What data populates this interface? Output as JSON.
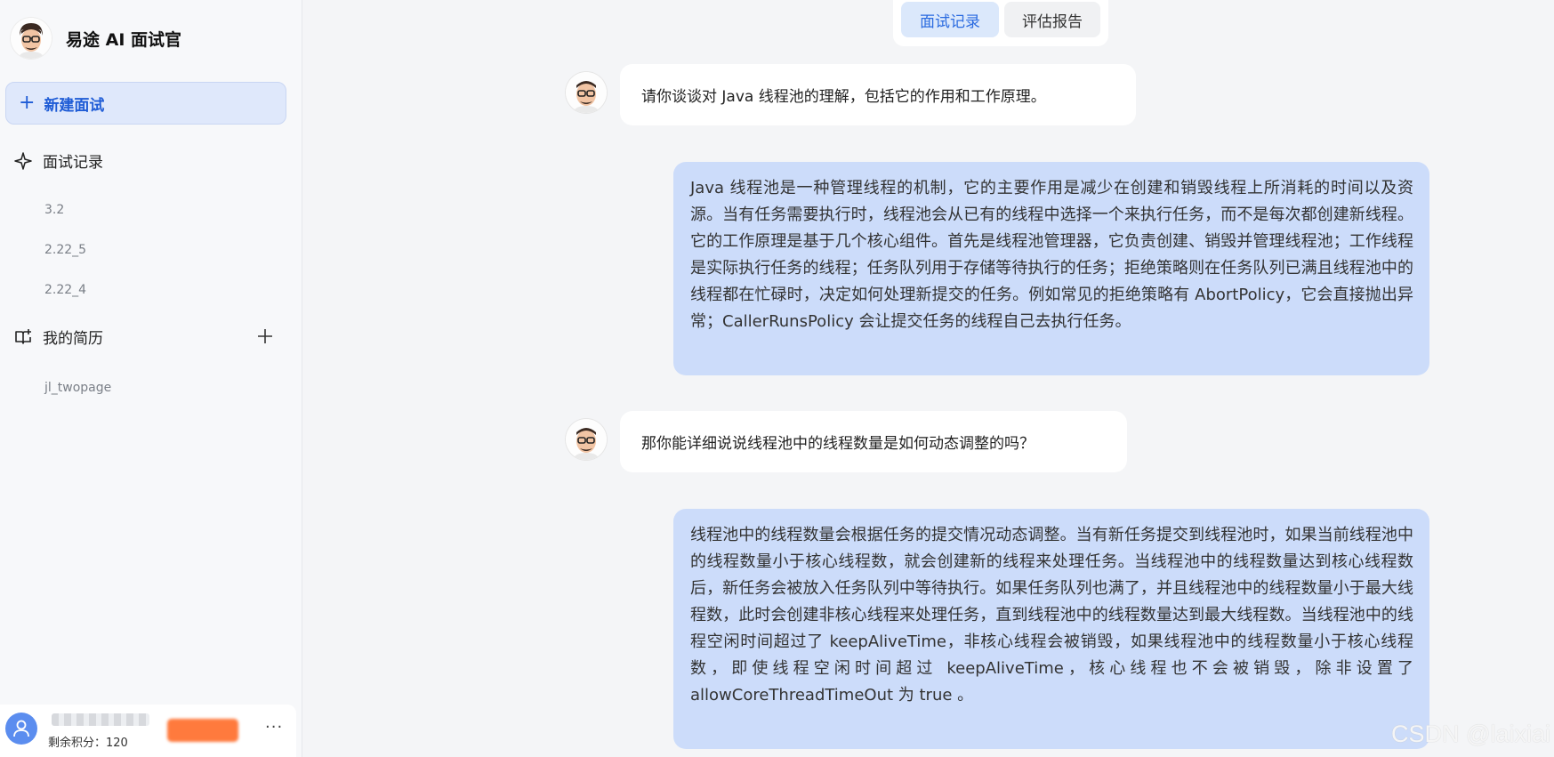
{
  "brand": {
    "title": "易途 AI 面试官"
  },
  "sidebar": {
    "new_interview": "新建面试",
    "records_label": "面试记录",
    "records": [
      "3.2",
      "2.22_5",
      "2.22_4"
    ],
    "resume_label": "我的简历",
    "resumes": [
      "jl_twopage"
    ]
  },
  "user": {
    "points_label": "剩余积分：",
    "points_value": "120",
    "more": "···"
  },
  "tabs": {
    "records": "面试记录",
    "report": "评估报告"
  },
  "chat": [
    {
      "role": "interviewer",
      "text": "请你谈谈对 Java 线程池的理解，包括它的作用和工作原理。"
    },
    {
      "role": "candidate",
      "text": "Java 线程池是一种管理线程的机制，它的主要作用是减少在创建和销毁线程上所消耗的时间以及资源。当有任务需要执行时，线程池会从已有的线程中选择一个来执行任务，而不是每次都创建新线程。它的工作原理是基于几个核心组件。首先是线程池管理器，它负责创建、销毁并管理线程池；工作线程是实际执行任务的线程；任务队列用于存储等待执行的任务；拒绝策略则在任务队列已满且线程池中的线程都在忙碌时，决定如何处理新提交的任务。例如常见的拒绝策略有 AbortPolicy，它会直接抛出异常；CallerRunsPolicy 会让提交任务的线程自己去执行任务。"
    },
    {
      "role": "interviewer",
      "text": "那你能详细说说线程池中的线程数量是如何动态调整的吗？"
    },
    {
      "role": "candidate",
      "text": "线程池中的线程数量会根据任务的提交情况动态调整。当有新任务提交到线程池时，如果当前线程池中的线程数量小于核心线程数，就会创建新的线程来处理任务。当线程池中的线程数量达到核心线程数后，新任务会被放入任务队列中等待执行。如果任务队列也满了，并且线程池中的线程数量小于最大线程数，此时会创建非核心线程来处理任务，直到线程池中的线程数量达到最大线程数。当线程池中的线程空闲时间超过了 keepAliveTime，非核心线程会被销毁，如果线程池中的线程数量小于核心线程数，即使线程空闲时间超过 keepAliveTime，核心线程也不会被销毁，除非设置了 allowCoreThreadTimeOut 为 true 。"
    }
  ],
  "watermark": "CSDN @laixiai",
  "colors": {
    "accent": "#2b6be0",
    "answer_bubble": "#ccdcfa",
    "sidebar_bg": "#f7f8fa"
  }
}
